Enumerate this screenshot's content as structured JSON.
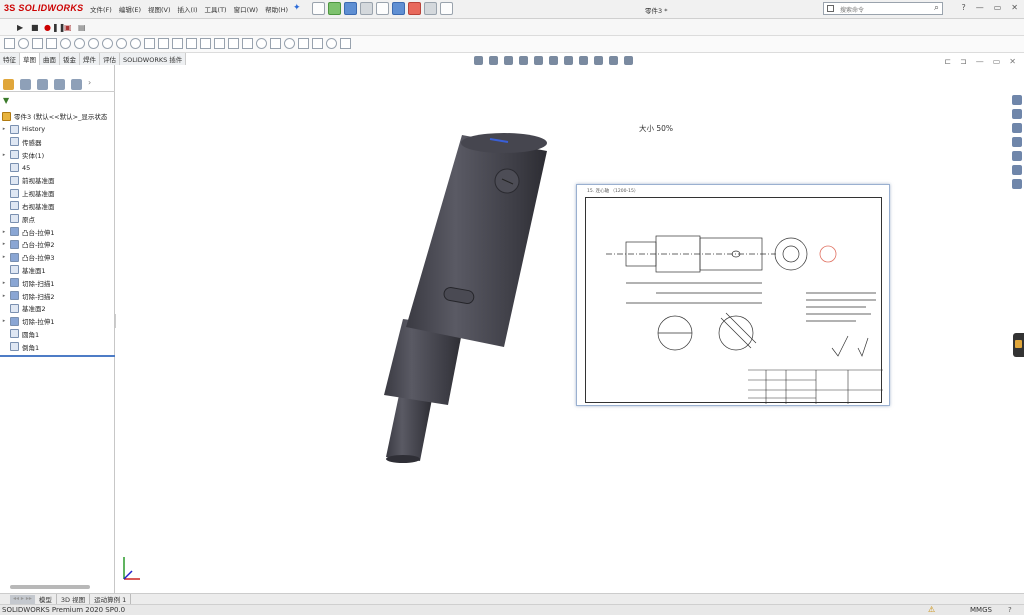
{
  "app": {
    "logo_brand": "SOLIDWORKS",
    "doc_title": "零件3 *"
  },
  "menu": [
    "文件(F)",
    "编辑(E)",
    "视图(V)",
    "插入(I)",
    "工具(T)",
    "窗口(W)",
    "帮助(H)"
  ],
  "search": {
    "placeholder": "搜索命令"
  },
  "window_controls": [
    "?",
    "—",
    "▭",
    "✕"
  ],
  "command_tabs": [
    {
      "label": "特征",
      "active": false
    },
    {
      "label": "草图",
      "active": true
    },
    {
      "label": "曲面",
      "active": false
    },
    {
      "label": "钣金",
      "active": false
    },
    {
      "label": "焊件",
      "active": false
    },
    {
      "label": "评估",
      "active": false
    },
    {
      "label": "SOLIDWORKS 插件",
      "active": false
    }
  ],
  "feature_tree": {
    "root": "零件3 (默认<<默认>_显示状态",
    "items": [
      {
        "label": "History",
        "icon": "history-icon",
        "expandable": true
      },
      {
        "label": "传感器",
        "icon": "sensor-icon",
        "expandable": false
      },
      {
        "label": "实体(1)",
        "icon": "solid-bodies-icon",
        "expandable": true
      },
      {
        "label": "45",
        "icon": "material-icon",
        "expandable": false
      },
      {
        "label": "前视基准面",
        "icon": "plane-icon",
        "expandable": false
      },
      {
        "label": "上视基准面",
        "icon": "plane-icon",
        "expandable": false
      },
      {
        "label": "右视基准面",
        "icon": "plane-icon",
        "expandable": false
      },
      {
        "label": "原点",
        "icon": "origin-icon",
        "expandable": false
      },
      {
        "label": "凸台-拉伸1",
        "icon": "extrude-icon",
        "expandable": true
      },
      {
        "label": "凸台-拉伸2",
        "icon": "extrude-icon",
        "expandable": true
      },
      {
        "label": "凸台-拉伸3",
        "icon": "extrude-icon",
        "expandable": true
      },
      {
        "label": "基准面1",
        "icon": "plane-icon",
        "expandable": false
      },
      {
        "label": "切除-扫描1",
        "icon": "cut-sweep-icon",
        "expandable": true
      },
      {
        "label": "切除-扫描2",
        "icon": "cut-sweep-icon",
        "expandable": true
      },
      {
        "label": "基准面2",
        "icon": "plane-icon",
        "expandable": false
      },
      {
        "label": "切除-拉伸1",
        "icon": "cut-extrude-icon",
        "expandable": true
      },
      {
        "label": "圆角1",
        "icon": "fillet-icon",
        "expandable": false
      },
      {
        "label": "倒角1",
        "icon": "chamfer-icon",
        "expandable": false
      }
    ]
  },
  "viewport": {
    "size_label": "大小 50%",
    "drawing_caption": "15. 连心轴 （1200-15）"
  },
  "bottom_tabs": [
    "模型",
    "3D 视图",
    "运动算例 1"
  ],
  "status": {
    "product": "SOLIDWORKS Premium 2020 SP0.0",
    "units": "MMGS",
    "help": "?"
  }
}
